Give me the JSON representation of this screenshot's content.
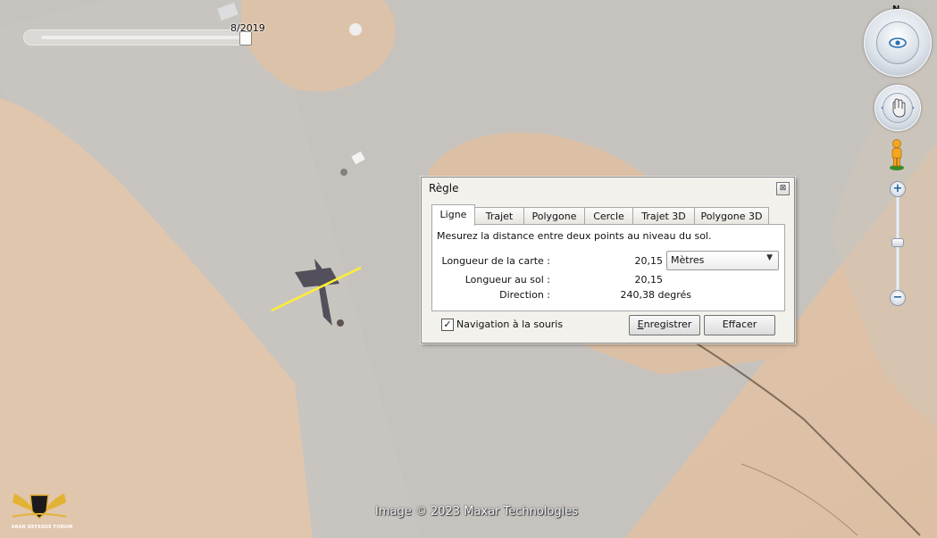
{
  "time_slider": {
    "label": "8/2019"
  },
  "navigation": {
    "north_label": "N",
    "look_icon": "eye-icon",
    "move_icon": "hand-icon",
    "street_view_icon": "pegman-icon",
    "zoom_in_label": "+",
    "zoom_out_label": "−",
    "accent_color": "#2a6fb3"
  },
  "attribution": "Image © 2023 Maxar Technologies",
  "watermark": {
    "text": "ARAB DEFENSE FORUM"
  },
  "ruler": {
    "title": "Règle",
    "close_label": "⊠",
    "tabs": [
      {
        "label": "Ligne",
        "active": true
      },
      {
        "label": "Trajet"
      },
      {
        "label": "Polygone"
      },
      {
        "label": "Cercle"
      },
      {
        "label": "Trajet 3D"
      },
      {
        "label": "Polygone 3D"
      }
    ],
    "description": "Mesurez la distance entre deux points au niveau du sol.",
    "map_length_label": "Longueur de la carte :",
    "map_length_value": "20,15",
    "units_selected": "Mètres",
    "ground_length_label": "Longueur au sol :",
    "ground_length_value": "20,15",
    "direction_label": "Direction :",
    "direction_value": "240,38 degrés",
    "mouse_nav_checked": true,
    "mouse_nav_check_mark": "✓",
    "mouse_nav_label": "Navigation à la souris",
    "save_label": "Enregistrer",
    "clear_label": "Effacer"
  },
  "measure_line_color": "#ffee33"
}
